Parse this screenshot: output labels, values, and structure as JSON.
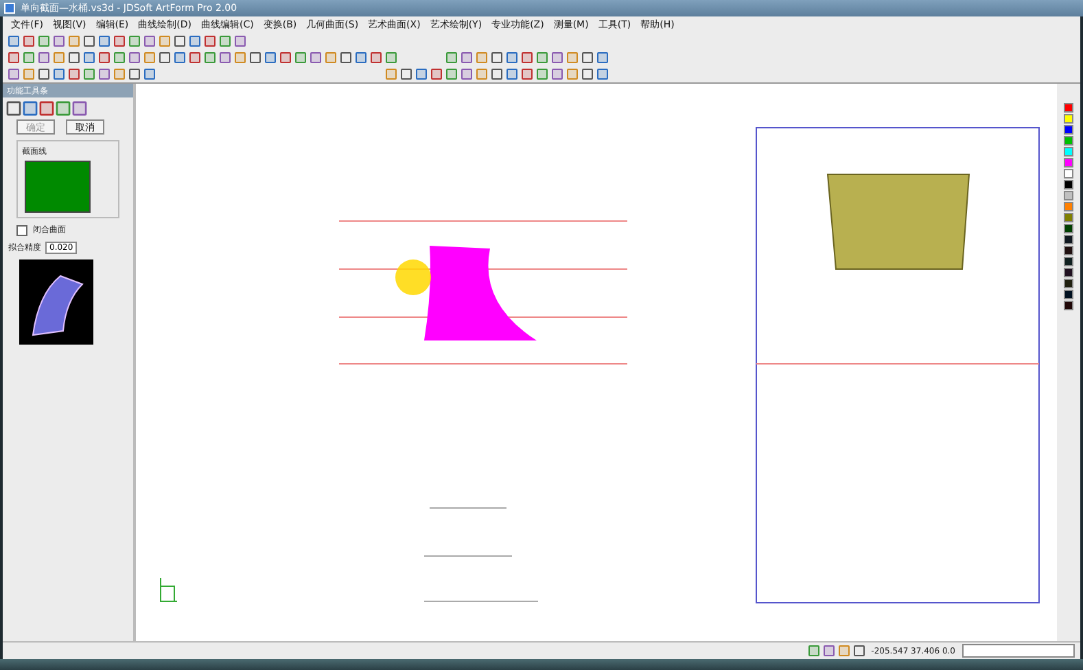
{
  "window": {
    "title": "单向截面—水桶.vs3d - JDSoft ArtForm Pro 2.00"
  },
  "menu": [
    "文件(F)",
    "视图(V)",
    "编辑(E)",
    "曲线绘制(D)",
    "曲线编辑(C)",
    "变换(B)",
    "几何曲面(S)",
    "艺术曲面(X)",
    "艺术绘制(Y)",
    "专业功能(Z)",
    "测量(M)",
    "工具(T)",
    "帮助(H)"
  ],
  "panel": {
    "title": "功能工具条",
    "ok_button": {
      "label": "确定",
      "disabled": true
    },
    "cancel_button": {
      "label": "取消",
      "disabled": false
    },
    "group_label": "截面线",
    "closed_surface": {
      "label": "闭合曲面",
      "checked": false
    },
    "precision": {
      "label": "拟合精度",
      "value": "0.020"
    }
  },
  "palette": [
    {
      "color": "#ff0000"
    },
    {
      "color": "#ffff00"
    },
    {
      "color": "#0000ff"
    },
    {
      "color": "#00c000"
    },
    {
      "color": "#00ffff"
    },
    {
      "color": "#ff00ff"
    },
    {
      "color": "#ffffff"
    },
    {
      "color": "#000000"
    },
    {
      "color": "#c0c0c0"
    },
    {
      "color": "#ff8000"
    },
    {
      "color": "#808000"
    },
    {
      "color": "#004000"
    },
    {
      "color": "#101820"
    },
    {
      "color": "#201010"
    },
    {
      "color": "#102020"
    },
    {
      "color": "#201020"
    },
    {
      "color": "#202010"
    },
    {
      "color": "#001020"
    },
    {
      "color": "#200808"
    }
  ],
  "status_bar": {
    "coordinates": "-205.547 37.406 0.0"
  }
}
